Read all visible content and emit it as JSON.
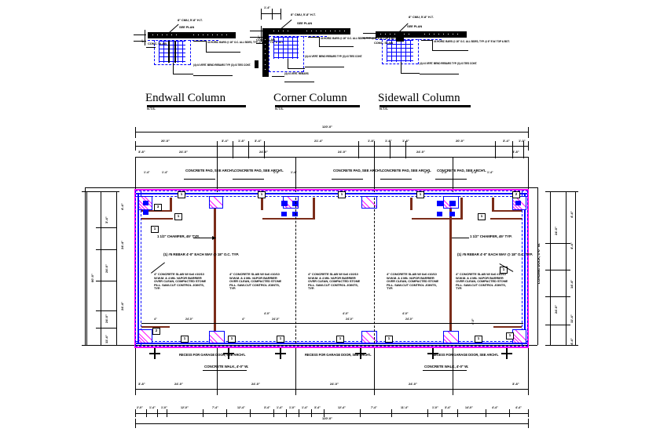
{
  "drawing": {
    "type": "foundation-plan",
    "details": [
      {
        "id": "endwall",
        "title": "Endwall Column",
        "tag": "N.T.S.",
        "callouts": [
          "8\" CMU, 5'-8\" H.T.",
          "SEE PLAN",
          "CONC. SLAB",
          "(4) #4 VERT. BEND REBARS TYP. (3) #3 TIES CONT.",
          "#4 HORIZ. BARS @ 16\" O.C. ALL SIDES, TYP. @ 6\" E.W. TOP & BOT."
        ]
      },
      {
        "id": "corner",
        "title": "Corner Column",
        "tag": "N.T.S.",
        "callouts": [
          "1'-4\"",
          "8\" CMU, 5'-8\" H.T.",
          "SEE PLAN",
          "CONC. SLAB",
          "(4) #4 VERT. BEND REBARS TYP. (3) #3 TIES CONT.",
          "#4 HORIZ. BARS @ 16\" O.C. ALL SIDES, TYP. @ 6\" E.W. TOP & BOT.",
          "(4) #4 VERT. REBARS"
        ]
      },
      {
        "id": "sidewall",
        "title": "Sidewall Column",
        "tag": "N.T.S.",
        "callouts": [
          "8\" CMU, 5'-8\" H.T.",
          "SEE PLAN",
          "CONC. SLAB",
          "(4) #4 VERT. BEND REBARS TYP. (3) #3 TIES CONT.",
          "#4 HORIZ. BARS @ 16\" O.C. ALL SIDES, TYP. @ 6\" E.W. TOP & BOT."
        ]
      }
    ],
    "plan": {
      "top_dims_row1": [
        "120'-0\""
      ],
      "top_dims_row2": [
        "20'-0\"",
        "3'-4\"",
        "1'-8\"",
        "3'-4\"",
        "21'-4\"",
        "1'-8\"",
        "1'-8\"",
        "1'-8\"",
        "20'-0\"",
        "3'-4\"",
        "1'-0\""
      ],
      "top_dims_row3": [
        "3'-8\"",
        "24'-0\"",
        "24'-0\"",
        "24'-0\"",
        "24'-0\"",
        "3'-8\""
      ],
      "bottom_dims_row1": [
        "3'-8\"",
        "24'-0\"",
        "24'-0\"",
        "24'-0\"",
        "24'-0\"",
        "3'-8\""
      ],
      "bottom_dims_row2": [
        "2'-0\"",
        "1'-4\"",
        "1'-0\"",
        "12'-0\"",
        "7'-4\"",
        "12'-4\"",
        "3'-4\"",
        "1'-4\"",
        "1'-0\"",
        "1'-4\"",
        "3'-4\"",
        "12'-4\"",
        "7'-4\"",
        "11'-4\"",
        "1'-0\"",
        "3'-4\"",
        "14'-0\"",
        "4'-4\"",
        "4'-4\""
      ],
      "bottom_dims_row3": [
        "120'-0\""
      ],
      "left_dims_outer": [
        "60'-0\""
      ],
      "left_dims_mid": [
        "3'-4\"",
        "24'-0\"",
        "24'-0\"",
        "11'-4\""
      ],
      "left_dims_inner": [
        "24'-4\"",
        "24'-4\"",
        "4'-4\""
      ],
      "right_dims_outer": [
        "24'-0\"",
        "24'-0\""
      ],
      "right_dims_inner": [
        "4'-4\"",
        "4'-4\"",
        "14'-4\"",
        "11'-4\"",
        "4'-4\""
      ],
      "plan_notes": [
        "1 1/2\" CHAMFER, 45° TYP.",
        "(1) #5 REBAR 4'-0\" EACH WAY @ 18\" O.C. TYP.",
        "4\" CONCRETE SLAB W/ 6x6 #10/10 W.W.M. & 4 MIL VAPOR BARRIER OVER CLEAN, COMPACTED STONE FILL. SAW-CUT CONTROL JOINTS, TYP.",
        "RECESS FOR GARAGE DOOR, SEE ARCH'L",
        "CONCRETE WALK, 4'-0\" W.",
        "LOADING DOCK, 4'-0\" W.",
        "CONCRETE PAD, SEE ARCH'L"
      ],
      "column_tags": [
        "1",
        "2",
        "3"
      ]
    }
  },
  "colors": {
    "line": "#000000",
    "reinforcing": "#0000ff",
    "footing_hatch": "#ff00ff",
    "structural": "#7b2d1a",
    "paper": "#ffffff"
  }
}
